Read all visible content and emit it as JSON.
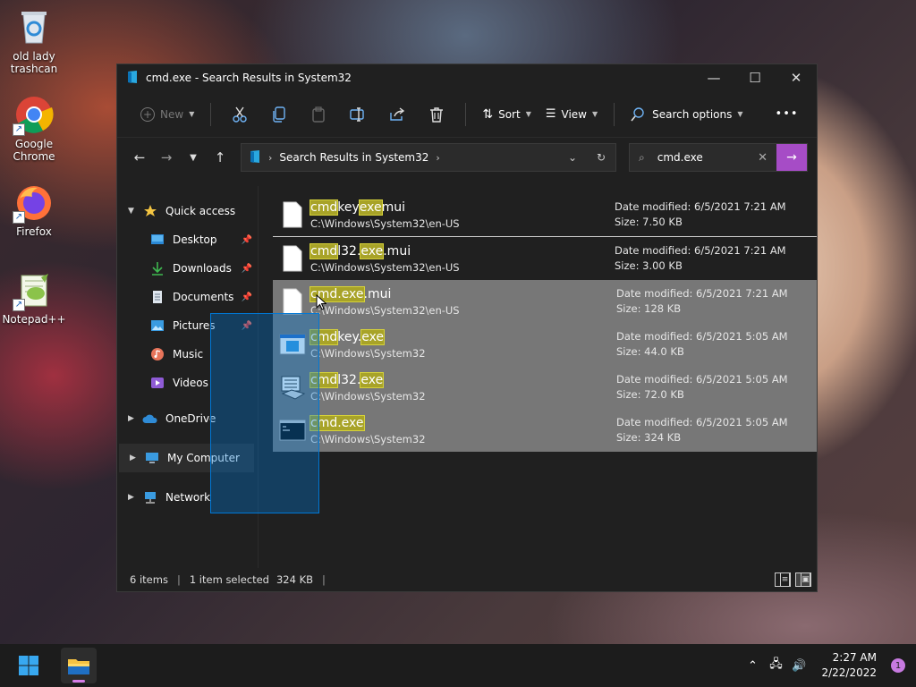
{
  "desktop": {
    "icons": [
      {
        "label_line1": "old lady",
        "label_line2": "trashcan",
        "icon": "recycle-bin-icon"
      },
      {
        "label_line1": "Google",
        "label_line2": "Chrome",
        "icon": "chrome-icon"
      },
      {
        "label_line1": "Firefox",
        "label_line2": "",
        "icon": "firefox-icon"
      },
      {
        "label_line1": "Notepad++",
        "label_line2": "",
        "icon": "notepad-plus-plus-icon"
      }
    ]
  },
  "window": {
    "title": "cmd.exe - Search Results in System32",
    "controls": {
      "minimize": "—",
      "maximize": "☐",
      "close": "✕"
    }
  },
  "toolbar": {
    "new_label": "New",
    "sort_label": "Sort",
    "view_label": "View",
    "search_options_label": "Search options",
    "more_label": "•••"
  },
  "address": {
    "crumb": "Search Results in System32",
    "search_value": "cmd.exe"
  },
  "nav": {
    "quick_access": "Quick access",
    "items": [
      {
        "label": "Desktop",
        "pinned": true
      },
      {
        "label": "Downloads",
        "pinned": true
      },
      {
        "label": "Documents",
        "pinned": true
      },
      {
        "label": "Pictures",
        "pinned": true
      },
      {
        "label": "Music",
        "pinned": false
      },
      {
        "label": "Videos",
        "pinned": false
      }
    ],
    "onedrive": "OneDrive",
    "my_computer": "My Computer",
    "network": "Network"
  },
  "files": [
    {
      "n1": "cmd",
      "n2": "key",
      "n3": "exe",
      "n4": "mui",
      "path": "C:\\Windows\\System32\\en-US",
      "modified_label": "Date modified:",
      "modified": "6/5/2021 7:21 AM",
      "size_label": "Size:",
      "size": "7.50 KB",
      "selected": false
    },
    {
      "n1": "cmd",
      "n2": "l32.",
      "n3": "exe",
      "n4": ".mui",
      "path": "C:\\Windows\\System32\\en-US",
      "modified_label": "Date modified:",
      "modified": "6/5/2021 7:21 AM",
      "size_label": "Size:",
      "size": "3.00 KB",
      "selected": false
    },
    {
      "n1": "cmd.exe",
      "n2": "",
      "n3": "",
      "n4": ".mui",
      "path": "C:\\Windows\\System32\\en-US",
      "modified_label": "Date modified:",
      "modified": "6/5/2021 7:21 AM",
      "size_label": "Size:",
      "size": "128 KB",
      "selected": true
    },
    {
      "n1": "cmd",
      "n2": "key.",
      "n3": "exe",
      "n4": "",
      "path": "C:\\Windows\\System32",
      "modified_label": "Date modified:",
      "modified": "6/5/2021 5:05 AM",
      "size_label": "Size:",
      "size": "44.0 KB",
      "selected": true
    },
    {
      "n1": "cmd",
      "n2": "l32.",
      "n3": "exe",
      "n4": "",
      "path": "C:\\Windows\\System32",
      "modified_label": "Date modified:",
      "modified": "6/5/2021 5:05 AM",
      "size_label": "Size:",
      "size": "72.0 KB",
      "selected": true
    },
    {
      "n1": "cmd.exe",
      "n2": "",
      "n3": "",
      "n4": "",
      "path": "C:\\Windows\\System32",
      "modified_label": "Date modified:",
      "modified": "6/5/2021 5:05 AM",
      "size_label": "Size:",
      "size": "324 KB",
      "selected": true
    }
  ],
  "status": {
    "items": "6 items",
    "selected": "1 item selected",
    "size": "324 KB"
  },
  "taskbar": {
    "time": "2:27 AM",
    "date": "2/22/2022",
    "notifications": "1"
  },
  "colors": {
    "accent": "#a64cc6",
    "highlight": "#a8a328",
    "selection": "#777777",
    "marquee": "#0078d7"
  }
}
